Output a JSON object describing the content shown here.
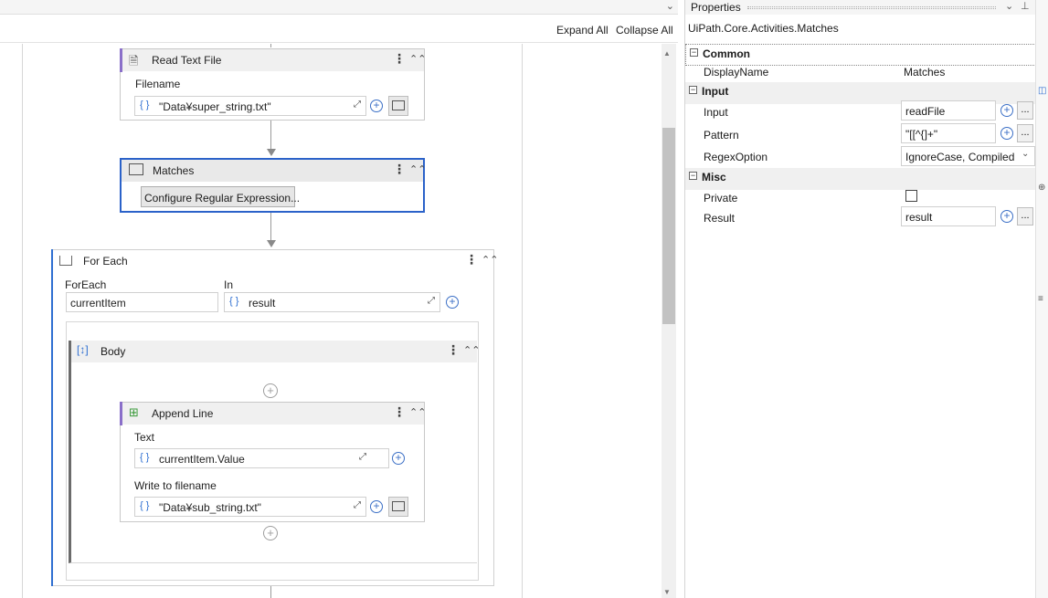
{
  "toolbar": {
    "expand_all": "Expand All",
    "collapse_all": "Collapse All"
  },
  "activities": {
    "read_text_file": {
      "title": "Read Text File",
      "filename_label": "Filename",
      "filename_value": "\"Data¥super_string.txt\""
    },
    "matches": {
      "title": "Matches",
      "configure_button": "Configure Regular Expression..."
    },
    "for_each": {
      "title": "For Each",
      "foreach_label": "ForEach",
      "foreach_value": "currentItem",
      "in_label": "In",
      "in_value": "result",
      "body": {
        "title": "Body",
        "append_line": {
          "title": "Append Line",
          "text_label": "Text",
          "text_value": "currentItem.Value",
          "write_label": "Write to filename",
          "write_value": "\"Data¥sub_string.txt\""
        }
      }
    }
  },
  "properties": {
    "panel_title": "Properties",
    "activity_type": "UiPath.Core.Activities.Matches",
    "categories": {
      "common": "Common",
      "input": "Input",
      "misc": "Misc"
    },
    "rows": {
      "displayname_label": "DisplayName",
      "displayname_value": "Matches",
      "input_label": "Input",
      "input_value": "readFile",
      "pattern_label": "Pattern",
      "pattern_value": "\"[[^{]+\"",
      "regexoption_label": "RegexOption",
      "regexoption_value": "IgnoreCase, Compiled",
      "private_label": "Private",
      "result_label": "Result",
      "result_value": "result"
    },
    "ellipsis": "..."
  },
  "colors": {
    "accent": "#2f6fd1",
    "selected_border": "#2b62c9",
    "activity_bar": "#8a6fc9"
  }
}
